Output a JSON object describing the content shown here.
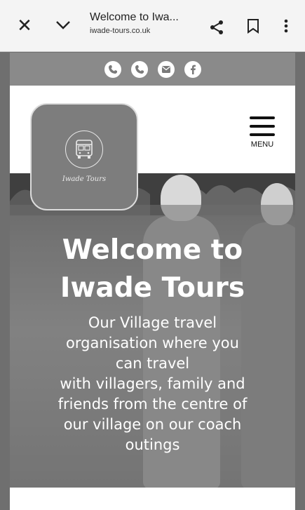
{
  "browser": {
    "page_title": "Welcome to Iwa...",
    "url": "iwade-tours.co.uk",
    "close_icon": "close-icon",
    "collapse_icon": "chevron-down-icon",
    "share_icon": "share-icon",
    "bookmark_icon": "bookmark-icon",
    "more_icon": "more-vertical-icon"
  },
  "contact_bar": {
    "icons": [
      "phone-icon",
      "phone-icon",
      "email-icon",
      "facebook-icon"
    ]
  },
  "header": {
    "logo_text": "Iwade Tours",
    "logo_icon": "bus-icon",
    "menu_label": "MENU"
  },
  "hero": {
    "title_line1": "Welcome to",
    "title_line2": "Iwade Tours",
    "text_lines": [
      "Our Village travel",
      "organisation where you",
      "can travel",
      "with villagers, family and",
      "friends from the centre of",
      "our village on our coach",
      "outings"
    ]
  }
}
